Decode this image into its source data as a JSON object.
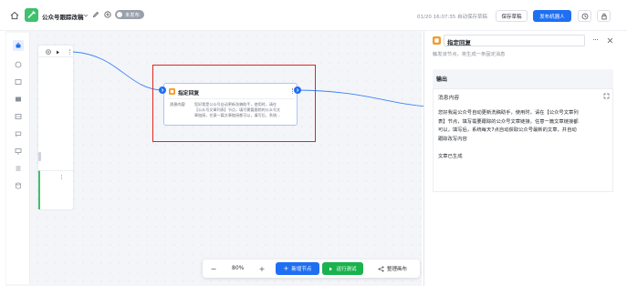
{
  "header": {
    "title": "公众号跟踪改稿",
    "status_badge": "未发布",
    "autosave": "01/20 16:07:35 自动保存草稿",
    "save_draft": "保存草稿",
    "publish": "发布机器人"
  },
  "node": {
    "title": "指定回复",
    "label": "消息内容",
    "content_line1": "您好我是公众号自动更新洗稿助手，使用时，请在",
    "content_line2": "【公众号文章列表】节点，填写需要跟踪的公众号文",
    "content_line3": "章链接，任意一篇文章链接都可以，填写后，系统..."
  },
  "panel": {
    "title": "指定回复",
    "description": "触发该节点，将生成一条固定消息",
    "section_title": "输出",
    "field_label": "消息内容",
    "content_lines": [
      "您好我是公众号自动更新洗稿助手，使用时，请在【公众号文章列",
      "表】节点，填写需要跟踪的公众号文章链接，任意一篇文章链接都",
      "可以，填写后，系统每天7点自动获取公众号最新的文章，并自动",
      "跟踪改写内容"
    ],
    "generated": "文章已生成"
  },
  "bottom_toolbar": {
    "zoom_out": "−",
    "zoom": "80%",
    "zoom_in": "+",
    "add_node": "新增节点",
    "run_test": "运行测试",
    "tidy": "整理画布"
  },
  "colors": {
    "accent": "#1f6ff2",
    "green": "#19b24d",
    "highlight_red": "#e1251b",
    "node_orange": "#f29b2a",
    "logo_green": "#3fc16d"
  }
}
